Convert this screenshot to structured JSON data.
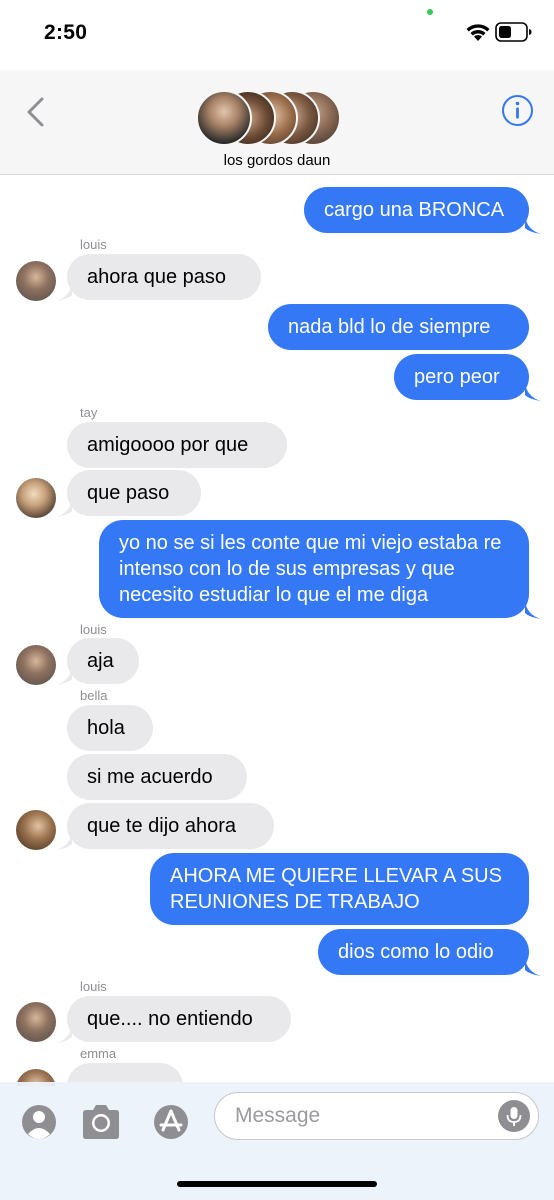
{
  "status": {
    "time": "2:50"
  },
  "header": {
    "group_name": "los gordos daun"
  },
  "messages": [
    {
      "side": "out",
      "text": "cargo una BRONCA"
    },
    {
      "side": "in",
      "sender": "louis",
      "text": "ahora que paso"
    },
    {
      "side": "out",
      "text": "nada bld lo de siempre"
    },
    {
      "side": "out",
      "text": "pero peor"
    },
    {
      "side": "in",
      "sender": "tay",
      "text": "amigoooo por que"
    },
    {
      "side": "in",
      "text": "que paso"
    },
    {
      "side": "out",
      "text": "yo no se si les conte que mi viejo estaba re intenso con lo de sus empresas y que necesito estudiar lo que el me diga"
    },
    {
      "side": "in",
      "sender": "louis",
      "text": "aja"
    },
    {
      "side": "in",
      "sender": "bella",
      "text": "hola"
    },
    {
      "side": "in",
      "text": "si me acuerdo"
    },
    {
      "side": "in",
      "text": "que te dijo ahora"
    },
    {
      "side": "out",
      "text": "AHORA ME QUIERE LLEVAR A SUS REUNIONES DE TRABAJO"
    },
    {
      "side": "out",
      "text": "dios como lo odio"
    },
    {
      "side": "in",
      "sender": "louis",
      "text": "que.... no entiendo"
    },
    {
      "side": "in",
      "sender": "emma",
      "text": ""
    }
  ],
  "input": {
    "placeholder": "Message"
  },
  "colors": {
    "outgoing": "#3478f6",
    "incoming": "#e9e9eb",
    "accent": "#3478f6"
  },
  "icons": [
    "back-chevron-icon",
    "info-icon",
    "memoji-icon",
    "camera-icon",
    "app-store-icon",
    "microphone-icon",
    "wifi-icon",
    "battery-icon"
  ]
}
